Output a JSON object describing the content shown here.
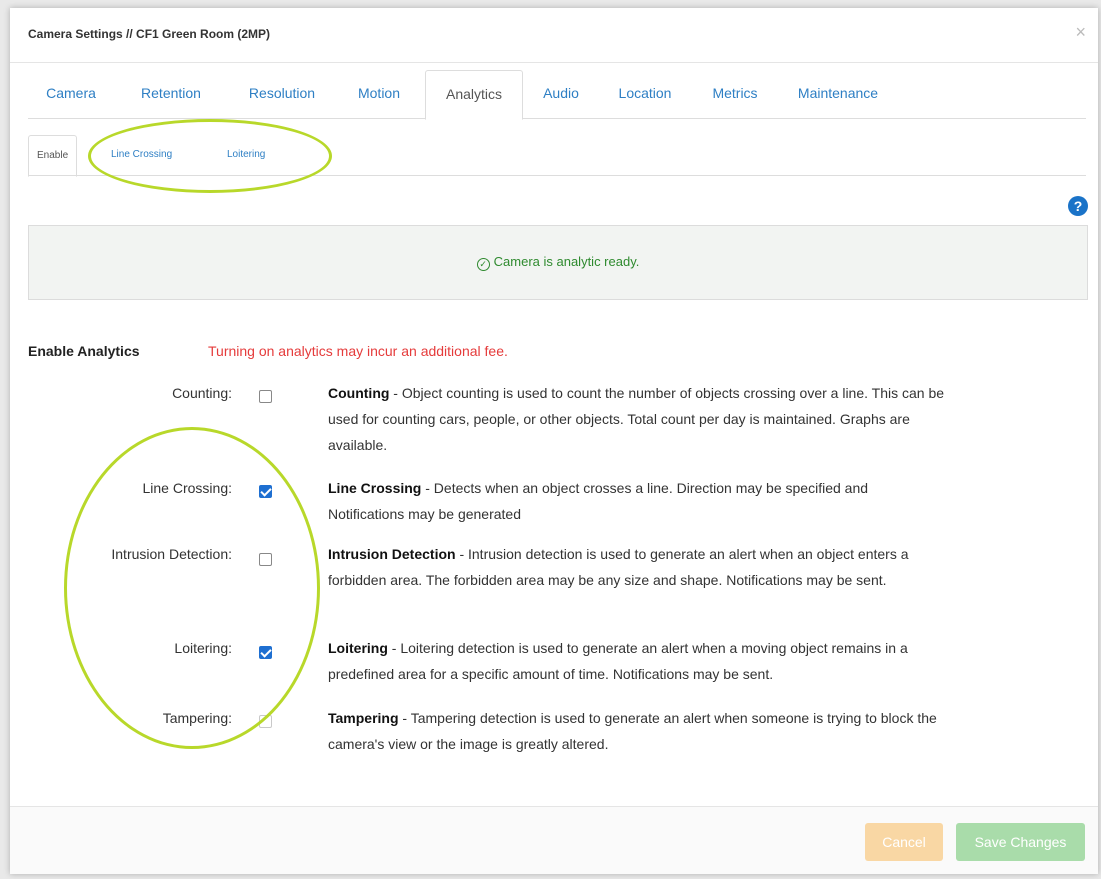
{
  "modal": {
    "title": "Camera Settings // CF1 Green Room (2MP)",
    "close_glyph": "×"
  },
  "tabs": [
    {
      "label": "Camera"
    },
    {
      "label": "Retention"
    },
    {
      "label": "Resolution"
    },
    {
      "label": "Motion"
    },
    {
      "label": "Analytics",
      "active": true
    },
    {
      "label": "Audio"
    },
    {
      "label": "Location"
    },
    {
      "label": "Metrics"
    },
    {
      "label": "Maintenance"
    }
  ],
  "subtabs": [
    {
      "label": "Enable",
      "active": true
    },
    {
      "label": "Line Crossing"
    },
    {
      "label": "Loitering"
    }
  ],
  "help_icon": {
    "glyph": "?"
  },
  "status": {
    "icon": "check-circle-icon",
    "text": "Camera is analytic ready."
  },
  "section": {
    "title": "Enable Analytics",
    "warning": "Turning on analytics may incur an additional fee."
  },
  "analytics": [
    {
      "label": "Counting:",
      "checked": false,
      "name": "Counting",
      "description": " - Object counting is used to count the number of objects crossing over a line. This can be used for counting cars, people, or other objects. Total count per day is maintained. Graphs are available."
    },
    {
      "label": "Line Crossing:",
      "checked": true,
      "name": "Line Crossing",
      "description": " - Detects when an object crosses a line. Direction may be specified and Notifications may be generated"
    },
    {
      "label": "Intrusion Detection:",
      "checked": false,
      "name": "Intrusion Detection",
      "description": " - Intrusion detection is used to generate an alert when an object enters a forbidden area. The forbidden area may be any size and shape. Notifications may be sent."
    },
    {
      "label": "Loitering:",
      "checked": true,
      "name": "Loitering",
      "description": " - Loitering detection is used to generate an alert when a moving object remains in a predefined area for a specific amount of time. Notifications may be sent."
    },
    {
      "label": "Tampering:",
      "checked": false,
      "name": "Tampering",
      "description": " - Tampering detection is used to generate an alert when someone is trying to block the camera's view or the image is greatly altered."
    }
  ],
  "footer": {
    "cancel_label": "Cancel",
    "save_label": "Save Changes"
  },
  "colors": {
    "link": "#2e7fc4",
    "status_green": "#2f8a2f",
    "warning_red": "#e53b3b",
    "checkbox_blue": "#1e6fd1",
    "highlight_lime": "#b8d82a",
    "cancel_orange": "#f9d7a4",
    "save_green": "#a9dcaa"
  }
}
